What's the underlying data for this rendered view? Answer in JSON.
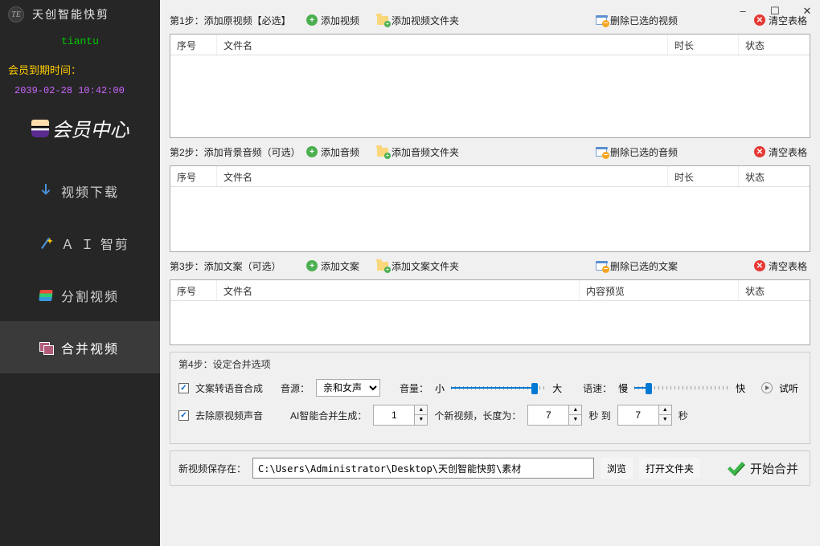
{
  "window": {
    "title": "天创智能快剪",
    "logo_text": "TE"
  },
  "sidebar": {
    "brand": "tiantu",
    "expiry_label": "会员到期时间：",
    "expiry_value": "2039-02-28 10:42:00",
    "member_center": "会员中心",
    "nav": [
      {
        "id": "download",
        "label": "视频下载"
      },
      {
        "id": "ai",
        "label": "Ａ Ｉ 智剪"
      },
      {
        "id": "split",
        "label": "分割视频"
      },
      {
        "id": "merge",
        "label": "合并视频",
        "active": true
      }
    ]
  },
  "steps": {
    "s1": {
      "label": "第1步：添加原视频【必选】",
      "add": "添加视频",
      "add_folder": "添加视频文件夹",
      "delete": "删除已选的视频",
      "clear": "清空表格"
    },
    "s2": {
      "label": "第2步：添加背景音频（可选）",
      "add": "添加音频",
      "add_folder": "添加音频文件夹",
      "delete": "删除已选的音频",
      "clear": "清空表格"
    },
    "s3": {
      "label": "第3步：添加文案（可选）",
      "add": "添加文案",
      "add_folder": "添加文案文件夹",
      "delete": "删除已选的文案",
      "clear": "清空表格"
    }
  },
  "tables": {
    "video": {
      "cols": {
        "index": "序号",
        "name": "文件名",
        "duration": "时长",
        "status": "状态"
      }
    },
    "audio": {
      "cols": {
        "index": "序号",
        "name": "文件名",
        "duration": "时长",
        "status": "状态"
      }
    },
    "text": {
      "cols": {
        "index": "序号",
        "name": "文件名",
        "preview": "内容预览",
        "status": "状态"
      }
    }
  },
  "step4": {
    "title": "第4步：设定合并选项",
    "tts_checkbox": "文案转语音合成",
    "voice_label": "音源：",
    "voice_value": "亲和女声",
    "volume_label": "音量：",
    "volume_min": "小",
    "volume_max": "大",
    "volume_pct": 85,
    "speed_label": "语速：",
    "speed_min": "慢",
    "speed_max": "快",
    "speed_pct": 12,
    "preview": "试听",
    "strip_audio_checkbox": "去除原视频声音",
    "ai_merge_label": "AI智能合并生成：",
    "count_value": "1",
    "count_suffix": "个新视频，长度为：",
    "len_from": "7",
    "len_mid": "秒 到",
    "len_to": "7",
    "len_suffix": "秒"
  },
  "bottom": {
    "save_label": "新视频保存在：",
    "path": "C:\\Users\\Administrator\\Desktop\\天创智能快剪\\素材",
    "browse": "浏览",
    "open_folder": "打开文件夹",
    "start": "开始合并"
  }
}
